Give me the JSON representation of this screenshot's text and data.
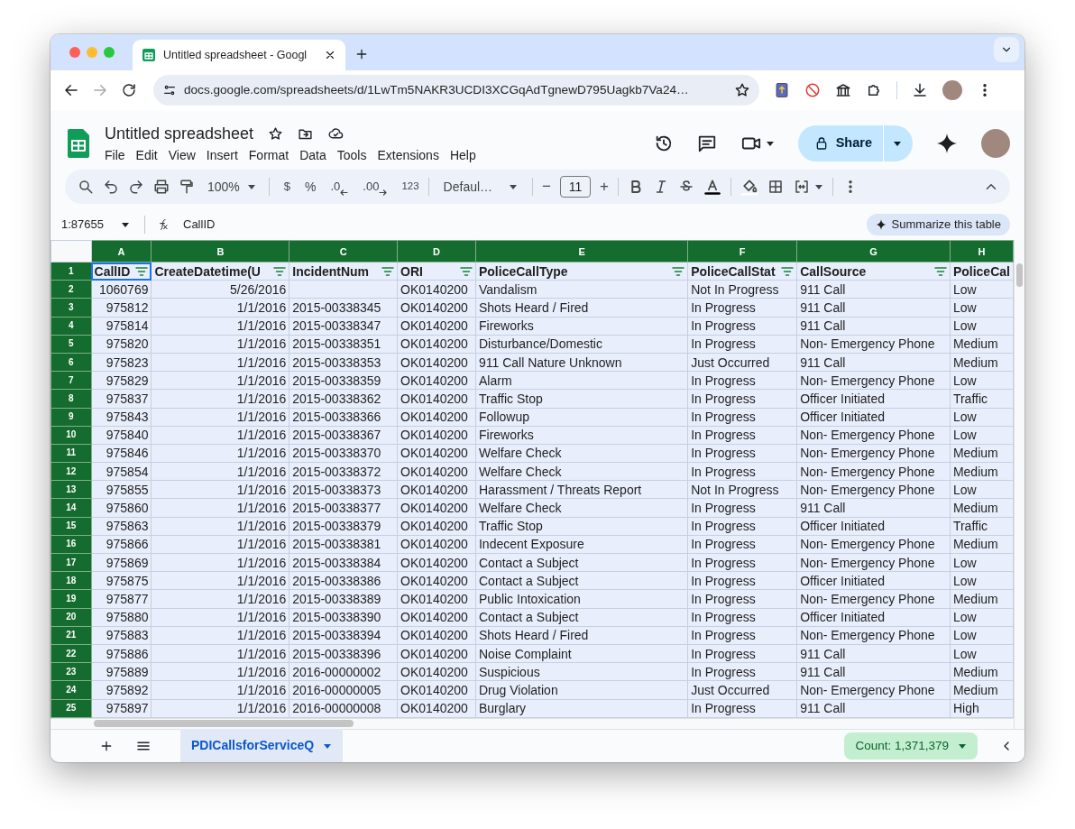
{
  "browser": {
    "tab": {
      "title": "Untitled spreadsheet - Googl"
    },
    "address": "docs.google.com/spreadsheets/d/1LwTm5NAKR3UCDI3XCGqAdTgnewD795Uagkb7Va24…"
  },
  "document": {
    "title": "Untitled spreadsheet",
    "menus": [
      "File",
      "Edit",
      "View",
      "Insert",
      "Format",
      "Data",
      "Tools",
      "Extensions",
      "Help"
    ],
    "share": "Share"
  },
  "toolbar": {
    "zoom": "100%",
    "currency": "$",
    "percent": "%",
    "decrease_decimal": ".0",
    "increase_decimal": ".00",
    "number_format": "123",
    "font": "Defaul…",
    "decrease_size": "−",
    "font_size": "11",
    "increase_size": "+"
  },
  "formula_bar": {
    "name_box": "1:87655",
    "value": "CallID",
    "summarize": "Summarize this table"
  },
  "sheet": {
    "columns": [
      {
        "letter": "A",
        "kind": "number",
        "selected": true,
        "filter": true,
        "active": true
      },
      {
        "letter": "B",
        "kind": "number",
        "selected": true,
        "filter": true,
        "active": false
      },
      {
        "letter": "C",
        "kind": "text",
        "selected": true,
        "filter": true,
        "active": false
      },
      {
        "letter": "D",
        "kind": "text",
        "selected": true,
        "filter": true,
        "active": false
      },
      {
        "letter": "E",
        "kind": "text",
        "selected": true,
        "filter": true,
        "active": false
      },
      {
        "letter": "F",
        "kind": "text",
        "selected": true,
        "filter": true,
        "active": false
      },
      {
        "letter": "G",
        "kind": "text",
        "selected": true,
        "filter": true,
        "active": false
      },
      {
        "letter": "H",
        "kind": "text",
        "selected": true,
        "filter": false,
        "active": false
      }
    ],
    "rows": [
      {
        "number": "1",
        "kind": "header",
        "selected": true,
        "cells": [
          "CallID",
          "CreateDatetime(U",
          "IncidentNum",
          "ORI",
          "PoliceCallType",
          "PoliceCallStat",
          "CallSource",
          "PoliceCal"
        ]
      },
      {
        "number": "2",
        "kind": "data",
        "selected": true,
        "cells": [
          "1060769",
          "5/26/2016",
          null,
          "OK0140200",
          "Vandalism",
          "Not In Progress",
          "911 Call",
          "Low"
        ]
      },
      {
        "number": "3",
        "kind": "data",
        "selected": true,
        "cells": [
          "975812",
          "1/1/2016",
          "2015-00338345",
          "OK0140200",
          "Shots Heard / Fired",
          "In Progress",
          "911 Call",
          "Low"
        ]
      },
      {
        "number": "4",
        "kind": "data",
        "selected": true,
        "cells": [
          "975814",
          "1/1/2016",
          "2015-00338347",
          "OK0140200",
          "Fireworks",
          "In Progress",
          "911 Call",
          "Low"
        ]
      },
      {
        "number": "5",
        "kind": "data",
        "selected": true,
        "cells": [
          "975820",
          "1/1/2016",
          "2015-00338351",
          "OK0140200",
          "Disturbance/Domestic",
          "In Progress",
          "Non- Emergency Phone",
          "Medium"
        ]
      },
      {
        "number": "6",
        "kind": "data",
        "selected": true,
        "cells": [
          "975823",
          "1/1/2016",
          "2015-00338353",
          "OK0140200",
          "911 Call Nature Unknown",
          "Just Occurred",
          "911 Call",
          "Medium"
        ]
      },
      {
        "number": "7",
        "kind": "data",
        "selected": true,
        "cells": [
          "975829",
          "1/1/2016",
          "2015-00338359",
          "OK0140200",
          "Alarm",
          "In Progress",
          "Non- Emergency Phone",
          "Low"
        ]
      },
      {
        "number": "8",
        "kind": "data",
        "selected": true,
        "cells": [
          "975837",
          "1/1/2016",
          "2015-00338362",
          "OK0140200",
          "Traffic Stop",
          "In Progress",
          "Officer Initiated",
          "Traffic"
        ]
      },
      {
        "number": "9",
        "kind": "data",
        "selected": true,
        "cells": [
          "975843",
          "1/1/2016",
          "2015-00338366",
          "OK0140200",
          "Followup",
          "In Progress",
          "Officer Initiated",
          "Low"
        ]
      },
      {
        "number": "10",
        "kind": "data",
        "selected": true,
        "cells": [
          "975840",
          "1/1/2016",
          "2015-00338367",
          "OK0140200",
          "Fireworks",
          "In Progress",
          "Non- Emergency Phone",
          "Low"
        ]
      },
      {
        "number": "11",
        "kind": "data",
        "selected": true,
        "cells": [
          "975846",
          "1/1/2016",
          "2015-00338370",
          "OK0140200",
          "Welfare Check",
          "In Progress",
          "Non- Emergency Phone",
          "Medium"
        ]
      },
      {
        "number": "12",
        "kind": "data",
        "selected": true,
        "cells": [
          "975854",
          "1/1/2016",
          "2015-00338372",
          "OK0140200",
          "Welfare Check",
          "In Progress",
          "Non- Emergency Phone",
          "Medium"
        ]
      },
      {
        "number": "13",
        "kind": "data",
        "selected": true,
        "cells": [
          "975855",
          "1/1/2016",
          "2015-00338373",
          "OK0140200",
          "Harassment / Threats Report",
          "Not In Progress",
          "Non- Emergency Phone",
          "Low"
        ]
      },
      {
        "number": "14",
        "kind": "data",
        "selected": true,
        "cells": [
          "975860",
          "1/1/2016",
          "2015-00338377",
          "OK0140200",
          "Welfare Check",
          "In Progress",
          "911 Call",
          "Medium"
        ]
      },
      {
        "number": "15",
        "kind": "data",
        "selected": true,
        "cells": [
          "975863",
          "1/1/2016",
          "2015-00338379",
          "OK0140200",
          "Traffic Stop",
          "In Progress",
          "Officer Initiated",
          "Traffic"
        ]
      },
      {
        "number": "16",
        "kind": "data",
        "selected": true,
        "cells": [
          "975866",
          "1/1/2016",
          "2015-00338381",
          "OK0140200",
          "Indecent Exposure",
          "In Progress",
          "Non- Emergency Phone",
          "Medium"
        ]
      },
      {
        "number": "17",
        "kind": "data",
        "selected": true,
        "cells": [
          "975869",
          "1/1/2016",
          "2015-00338384",
          "OK0140200",
          "Contact a Subject",
          "In Progress",
          "Non- Emergency Phone",
          "Low"
        ]
      },
      {
        "number": "18",
        "kind": "data",
        "selected": true,
        "cells": [
          "975875",
          "1/1/2016",
          "2015-00338386",
          "OK0140200",
          "Contact a Subject",
          "In Progress",
          "Officer Initiated",
          "Low"
        ]
      },
      {
        "number": "19",
        "kind": "data",
        "selected": true,
        "cells": [
          "975877",
          "1/1/2016",
          "2015-00338389",
          "OK0140200",
          "Public Intoxication",
          "In Progress",
          "Non- Emergency Phone",
          "Medium"
        ]
      },
      {
        "number": "20",
        "kind": "data",
        "selected": true,
        "cells": [
          "975880",
          "1/1/2016",
          "2015-00338390",
          "OK0140200",
          "Contact a Subject",
          "In Progress",
          "Officer Initiated",
          "Low"
        ]
      },
      {
        "number": "21",
        "kind": "data",
        "selected": true,
        "cells": [
          "975883",
          "1/1/2016",
          "2015-00338394",
          "OK0140200",
          "Shots Heard / Fired",
          "In Progress",
          "Non- Emergency Phone",
          "Low"
        ]
      },
      {
        "number": "22",
        "kind": "data",
        "selected": true,
        "cells": [
          "975886",
          "1/1/2016",
          "2015-00338396",
          "OK0140200",
          "Noise Complaint",
          "In Progress",
          "911 Call",
          "Low"
        ]
      },
      {
        "number": "23",
        "kind": "data",
        "selected": true,
        "cells": [
          "975889",
          "1/1/2016",
          "2016-00000002",
          "OK0140200",
          "Suspicious",
          "In Progress",
          "911 Call",
          "Medium"
        ]
      },
      {
        "number": "24",
        "kind": "data",
        "selected": true,
        "cells": [
          "975892",
          "1/1/2016",
          "2016-00000005",
          "OK0140200",
          "Drug Violation",
          "Just Occurred",
          "Non- Emergency Phone",
          "Medium"
        ]
      },
      {
        "number": "25",
        "kind": "data",
        "selected": true,
        "cells": [
          "975897",
          "1/1/2016",
          "2016-00000008",
          "OK0140200",
          "Burglary",
          "In Progress",
          "911 Call",
          "High"
        ]
      }
    ]
  },
  "sheet_tabs": [
    {
      "label": "PDICallsforServiceQ",
      "selected": true
    }
  ],
  "status": {
    "count": "Count: 1,371,379"
  }
}
